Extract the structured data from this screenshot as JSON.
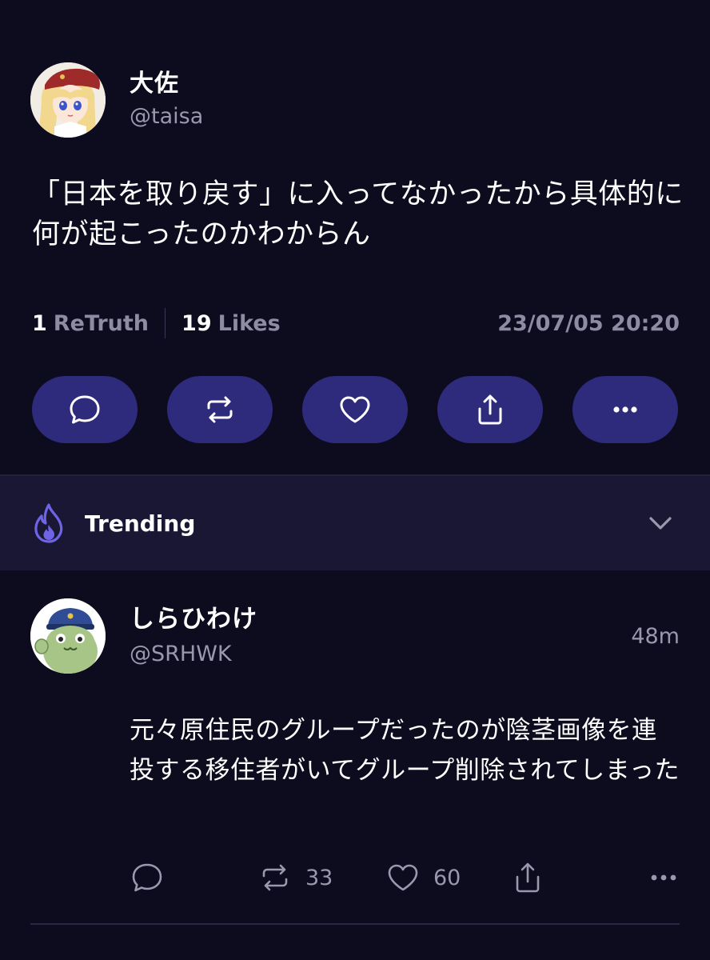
{
  "post": {
    "display_name": "大佐",
    "handle": "@taisa",
    "text": "「日本を取り戻す」に入ってなかったから具体的に何が起こったのかわからん",
    "retruth_count": "1",
    "retruth_label": "ReTruth",
    "likes_count": "19",
    "likes_label": "Likes",
    "timestamp": "23/07/05 20:20"
  },
  "trending": {
    "label": "Trending"
  },
  "reply": {
    "display_name": "しらひわけ",
    "handle": "@SRHWK",
    "time": "48m",
    "text": "元々原住民のグループだったのが陰茎画像を連投する移住者がいてグループ削除されてしまった",
    "retruth_count": "33",
    "like_count": "60"
  },
  "icons": {
    "action_buttons": [
      "speech-bubble-icon",
      "retruth-icon",
      "heart-icon",
      "share-icon",
      "more-icon"
    ],
    "trending": "flame-icon",
    "chevron": "chevron-down-icon"
  },
  "colors": {
    "background": "#0d0b1e",
    "action_pill": "#2e2a7c",
    "trending_bar": "#1a1735",
    "accent_flame": "#6f63e6",
    "muted_text": "#8e8ca3"
  }
}
